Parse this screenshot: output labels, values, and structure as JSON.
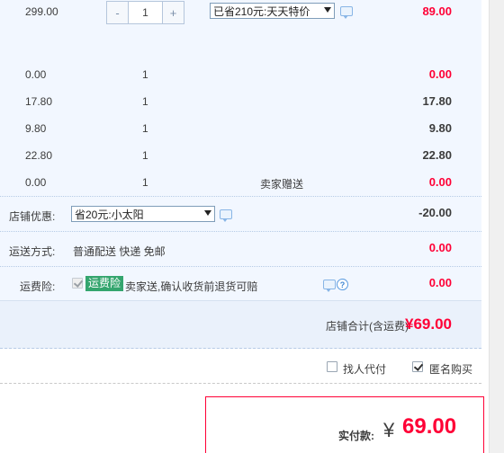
{
  "main_item": {
    "price": "299.00",
    "quantity": "1",
    "minus_label": "-",
    "plus_label": "+",
    "promo_select": "已省210元:天天特价",
    "subtotal": "89.00"
  },
  "sub_items": [
    {
      "price": "0.00",
      "quantity": "1",
      "note": "",
      "subtotal": "0.00"
    },
    {
      "price": "17.80",
      "quantity": "1",
      "note": "",
      "subtotal": "17.80"
    },
    {
      "price": "9.80",
      "quantity": "1",
      "note": "",
      "subtotal": "9.80"
    },
    {
      "price": "22.80",
      "quantity": "1",
      "note": "",
      "subtotal": "22.80"
    },
    {
      "price": "0.00",
      "quantity": "1",
      "note": "卖家赠送",
      "subtotal": "0.00"
    }
  ],
  "shop_discount": {
    "label": "店铺优惠:",
    "select": "省20元:小太阳",
    "amount": "-20.00"
  },
  "shipping": {
    "label": "运送方式:",
    "method": "普通配送 快递 免邮",
    "amount": "0.00"
  },
  "insurance": {
    "label": "运费险:",
    "tag": "运费险",
    "text": "卖家送,确认收货前退货可赔",
    "help_glyph": "?",
    "amount": "0.00"
  },
  "shop_total": {
    "label": "店铺合计(含运费)",
    "value": "¥69.00"
  },
  "options": {
    "proxy_pay": "找人代付",
    "anonymous": "匿名购买"
  },
  "payment": {
    "label": "实付款:",
    "currency": "¥",
    "amount": "69.00"
  },
  "colors": {
    "accent_red": "#ff0036",
    "panel_blue": "#f2f7ff",
    "insurance_green": "#34a56e"
  }
}
